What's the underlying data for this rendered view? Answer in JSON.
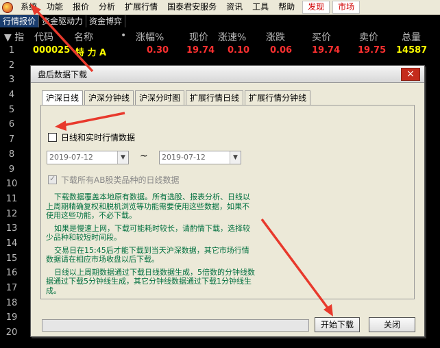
{
  "menubar": {
    "items": [
      "系统",
      "功能",
      "报价",
      "分析",
      "扩展行情",
      "国泰君安服务",
      "资讯",
      "工具",
      "帮助"
    ],
    "special": [
      "发现",
      "市场"
    ]
  },
  "tabs": [
    "行情报价",
    "资金驱动力",
    "资金博弈"
  ],
  "header": {
    "idx": "▼ 指",
    "code": "代码",
    "name": "名称",
    "dot": "•",
    "change_pct": "涨幅%",
    "price": "现价",
    "speed": "涨速%",
    "change": "涨跌",
    "bid": "买价",
    "ask": "卖价",
    "volume": "总量"
  },
  "rows": [
    {
      "idx": "1",
      "code": "000025",
      "name": "特 力 A",
      "change_pct": "0.30",
      "price": "19.74",
      "speed": "0.10",
      "change": "0.06",
      "bid": "19.74",
      "ask": "19.75",
      "volume": "14587"
    },
    {
      "idx": "2",
      "code": "",
      "name": "",
      "change_pct": "",
      "price": "",
      "speed": "",
      "change": "",
      "bid": "",
      "ask": "",
      "volume": ""
    },
    {
      "idx": "3"
    },
    {
      "idx": "4"
    },
    {
      "idx": "5"
    },
    {
      "idx": "6"
    },
    {
      "idx": "7"
    },
    {
      "idx": "8"
    },
    {
      "idx": "9"
    },
    {
      "idx": "10"
    },
    {
      "idx": "11"
    },
    {
      "idx": "12"
    },
    {
      "idx": "13"
    },
    {
      "idx": "14"
    },
    {
      "idx": "15"
    },
    {
      "idx": "16"
    },
    {
      "idx": "17"
    },
    {
      "idx": "18"
    },
    {
      "idx": "19"
    },
    {
      "idx": "20"
    }
  ],
  "dialog": {
    "title": "盘后数据下载",
    "close": "×",
    "tabs": [
      "沪深日线",
      "沪深分钟线",
      "沪深分时图",
      "扩展行情日线",
      "扩展行情分钟线"
    ],
    "checkbox_daily": "日线和实时行情数据",
    "date_from": "2019-07-12",
    "date_to": "2019-07-12",
    "tilde": "~",
    "checkbox_ab": "下载所有AB股类品种的日线数据",
    "note1": "下载数据覆盖本地原有数据。所有选股、报表分析、日线以上周期精确复权和脱机浏览等功能需要使用这些数据，如果不使用这些功能，不必下载。",
    "note2": "如果是慢速上网，下载可能耗时较长，请酌情下载，选择较少品种和较短时间段。",
    "note3": "交易日在15:45后才能下载到当天沪深数据，其它市场行情数据请在相应市场收盘以后下载。",
    "note4": "日线以上周期数据通过下载日线数据生成，5倍数的分钟线数据通过下载5分钟线生成，其它分钟线数据通过下载1分钟线生成。",
    "start_button": "开始下载",
    "close_button": "关闭"
  },
  "colors": {
    "red": "#ff3030",
    "yellow": "#ffff00",
    "annotation": "#e8392c"
  }
}
